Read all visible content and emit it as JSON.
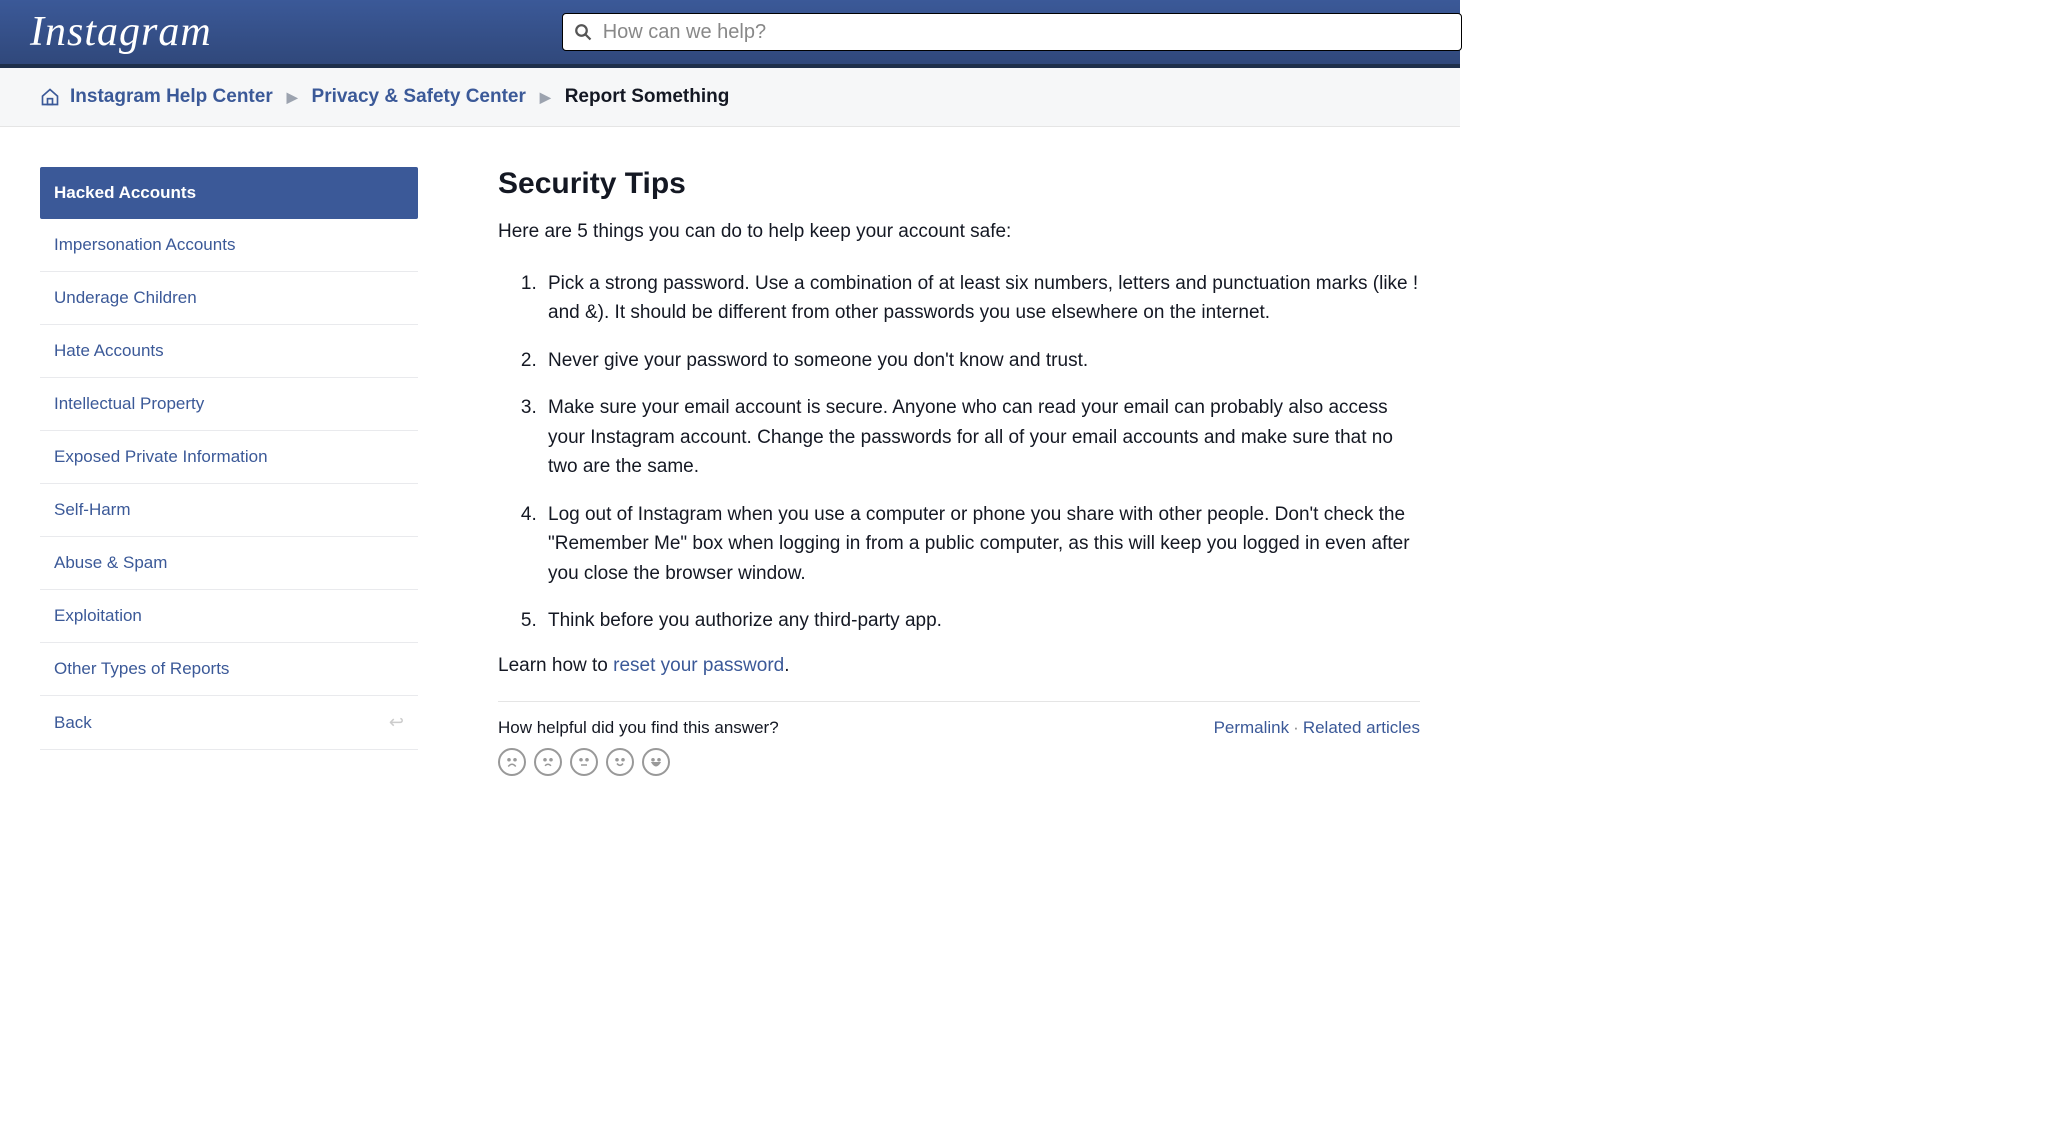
{
  "header": {
    "brand": "Instagram",
    "search_placeholder": "How can we help?"
  },
  "breadcrumbs": {
    "items": [
      {
        "label": "Instagram Help Center",
        "current": false
      },
      {
        "label": "Privacy & Safety Center",
        "current": false
      },
      {
        "label": "Report Something",
        "current": true
      }
    ]
  },
  "sidebar": {
    "items": [
      {
        "label": "Hacked Accounts",
        "active": true
      },
      {
        "label": "Impersonation Accounts",
        "active": false
      },
      {
        "label": "Underage Children",
        "active": false
      },
      {
        "label": "Hate Accounts",
        "active": false
      },
      {
        "label": "Intellectual Property",
        "active": false
      },
      {
        "label": "Exposed Private Information",
        "active": false
      },
      {
        "label": "Self-Harm",
        "active": false
      },
      {
        "label": "Abuse & Spam",
        "active": false
      },
      {
        "label": "Exploitation",
        "active": false
      },
      {
        "label": "Other Types of Reports",
        "active": false
      },
      {
        "label": "Back",
        "active": false,
        "back": true
      }
    ]
  },
  "main": {
    "title": "Security Tips",
    "intro": "Here are 5 things you can do to help keep your account safe:",
    "tips": [
      "Pick a strong password. Use a combination of at least six numbers, letters and punctuation marks (like ! and &). It should be different from other passwords you use elsewhere on the internet.",
      "Never give your password to someone you don't know and trust.",
      "Make sure your email account is secure. Anyone who can read your email can probably also access your Instagram account. Change the passwords for all of your email accounts and make sure that no two are the same.",
      "Log out of Instagram when you use a computer or phone you share with other people. Don't check the \"Remember Me\" box when logging in from a public computer, as this will keep you logged in even after you close the browser window.",
      "Think before you authorize any third-party app."
    ],
    "learn_prefix": "Learn how to ",
    "learn_link": "reset your password",
    "learn_suffix": ".",
    "feedback_prompt": "How helpful did you find this answer?",
    "permalink_label": "Permalink",
    "related_label": "Related articles"
  }
}
